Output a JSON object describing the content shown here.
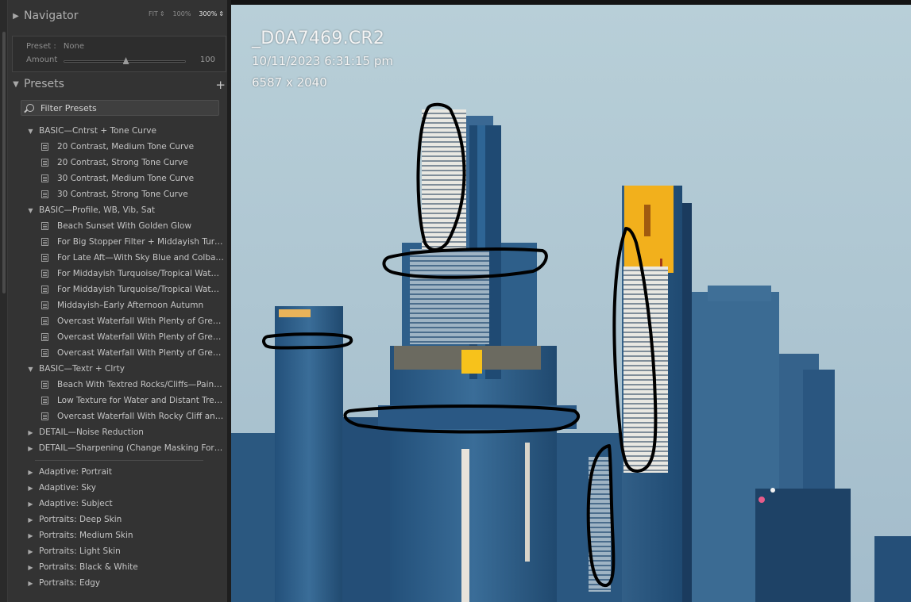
{
  "navigator": {
    "title": "Navigator",
    "zoom_options": [
      "FIT",
      "100%",
      "300%"
    ],
    "zoom_active": "300%"
  },
  "preset_amount": {
    "preset_label": "Preset :",
    "preset_value": "None",
    "amount_label": "Amount",
    "amount_value": "100",
    "amount_fraction": 0.51
  },
  "presets": {
    "title": "Presets",
    "add_label": "+",
    "filter_placeholder": "Filter Presets",
    "groups": [
      {
        "label": "BASIC—Cntrst + Tone Curve",
        "expanded": true,
        "items": [
          "20 Contrast, Medium Tone Curve",
          "20 Contrast, Strong Tone Curve",
          "30 Contrast, Medium Tone Curve",
          "30 Contrast, Strong Tone Curve"
        ]
      },
      {
        "label": "BASIC—Profile, WB, Vib, Sat",
        "expanded": true,
        "items": [
          "Beach Sunset With Golden Glow",
          "For Big Stopper Filter + Middayish Turq...",
          "For Late Aft—With Sky Blue and Colbal...",
          "For Middayish Turquoise/Tropical Water...",
          "For Middayish Turquoise/Tropical Water...",
          "Middayish–Early Afternoon Autumn",
          "Overcast Waterfall With Plenty of Gree...",
          "Overcast Waterfall With Plenty of Gree...",
          "Overcast Waterfall With Plenty of Gree..."
        ]
      },
      {
        "label": "BASIC—Textr + Clrty",
        "expanded": true,
        "items": [
          "Beach With Textred Rocks/Cliffs—Paint ...",
          "Low Texture for Water and Distant Tree...",
          "Overcast Waterfall With Rocky Cliff and..."
        ]
      },
      {
        "label": "DETAIL—Noise Reduction",
        "expanded": false,
        "items": []
      },
      {
        "label": "DETAIL—Sharpening (Change Masking For P...",
        "expanded": false,
        "items": []
      }
    ],
    "builtin_groups": [
      "Adaptive: Portrait",
      "Adaptive: Sky",
      "Adaptive: Subject",
      "Portraits: Deep Skin",
      "Portraits: Medium Skin",
      "Portraits: Light Skin",
      "Portraits: Black & White",
      "Portraits: Edgy"
    ]
  },
  "photo_info": {
    "file_name": "_D0A7469.CR2",
    "capture_time": "10/11/2023 6:31:15 pm",
    "dimensions": "6587 x 2040"
  },
  "colors": {
    "panel_bg": "#333333",
    "sky": "#a9c2cf",
    "building_blue": "#2c5f8c",
    "lit_windows": "#f3b51e",
    "annotation_ink": "#000000"
  }
}
